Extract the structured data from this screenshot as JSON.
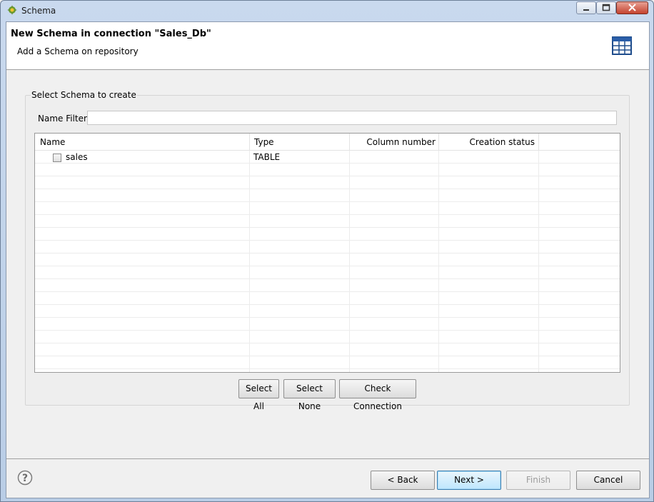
{
  "window": {
    "title": "Schema",
    "icon": "talend-app-icon"
  },
  "header": {
    "title": "New Schema in connection \"Sales_Db\"",
    "subtitle": "Add a Schema on repository",
    "icon": "table-grid-icon"
  },
  "group": {
    "legend": "Select Schema to create",
    "filter_label": "Name Filter:",
    "filter_value": ""
  },
  "table": {
    "columns": [
      "Name",
      "Type",
      "Column number",
      "Creation status"
    ],
    "rows": [
      {
        "checked": false,
        "name": "sales",
        "type": "TABLE",
        "column_number": "",
        "creation_status": ""
      }
    ]
  },
  "actions": {
    "select_all": "Select All",
    "select_none": "Select None",
    "check_connection": "Check Connection"
  },
  "footer": {
    "back": "< Back",
    "next": "Next >",
    "finish": "Finish",
    "cancel": "Cancel",
    "help_icon": "help-question-icon"
  }
}
